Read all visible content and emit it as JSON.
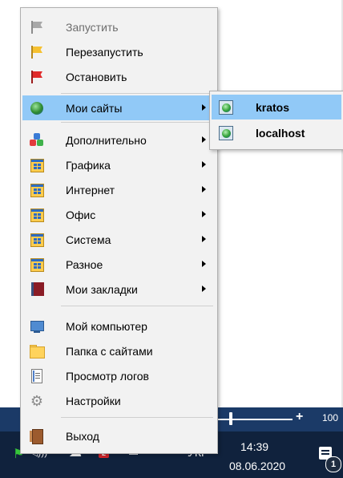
{
  "main_menu": {
    "items": [
      {
        "label": "Запустить",
        "icon": "gray-flag-icon",
        "disabled": true
      },
      {
        "label": "Перезапустить",
        "icon": "yellow-flag-icon"
      },
      {
        "label": "Остановить",
        "icon": "red-flag-icon"
      },
      {
        "label": "Мои сайты",
        "icon": "globe-icon",
        "submenu": true,
        "highlighted": true
      },
      {
        "label": "Дополнительно",
        "icon": "blocks-icon",
        "submenu": true
      },
      {
        "label": "Графика",
        "icon": "program-group-icon",
        "submenu": true
      },
      {
        "label": "Интернет",
        "icon": "program-group-icon",
        "submenu": true
      },
      {
        "label": "Офис",
        "icon": "program-group-icon",
        "submenu": true
      },
      {
        "label": "Система",
        "icon": "program-group-icon",
        "submenu": true
      },
      {
        "label": "Разное",
        "icon": "program-group-icon",
        "submenu": true
      },
      {
        "label": "Мои закладки",
        "icon": "bookmark-book-icon",
        "submenu": true
      },
      {
        "label": "Мой компьютер",
        "icon": "computer-icon"
      },
      {
        "label": "Папка с сайтами",
        "icon": "folder-icon"
      },
      {
        "label": "Просмотр логов",
        "icon": "log-icon"
      },
      {
        "label": "Настройки",
        "icon": "gear-icon"
      },
      {
        "label": "Выход",
        "icon": "exit-door-icon"
      }
    ]
  },
  "sub_menu": {
    "items": [
      {
        "label": "kratos",
        "icon": "site-globe-icon",
        "highlighted": true
      },
      {
        "label": "localhost",
        "icon": "site-globe-icon"
      }
    ]
  },
  "taskbar": {
    "volume_value": "100",
    "notification_badge": "2",
    "language": "УКР",
    "time": "14:39",
    "date": "08.06.2020",
    "notification_count": "1"
  },
  "colors": {
    "menu_bg": "#f2f2f2",
    "highlight": "#91c9f7",
    "taskbar": "#10223d",
    "slider_bar": "#1b3a67"
  }
}
